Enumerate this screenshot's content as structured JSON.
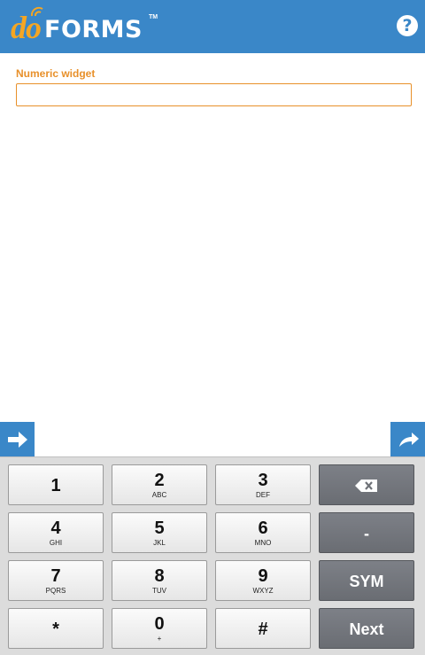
{
  "header": {
    "logo_do": "do",
    "logo_forms": "FORMS",
    "logo_tm": "TM",
    "help_label": "?"
  },
  "form": {
    "field_label": "Numeric widget",
    "field_value": ""
  },
  "keyboard": {
    "rows": [
      [
        {
          "main": "1",
          "sub": ""
        },
        {
          "main": "2",
          "sub": "ABC"
        },
        {
          "main": "3",
          "sub": "DEF"
        }
      ],
      [
        {
          "main": "4",
          "sub": "GHI"
        },
        {
          "main": "5",
          "sub": "JKL"
        },
        {
          "main": "6",
          "sub": "MNO"
        }
      ],
      [
        {
          "main": "7",
          "sub": "PQRS"
        },
        {
          "main": "8",
          "sub": "TUV"
        },
        {
          "main": "9",
          "sub": "WXYZ"
        }
      ],
      [
        {
          "main": "*",
          "sub": ""
        },
        {
          "main": "0",
          "sub": "+"
        },
        {
          "main": "#",
          "sub": ""
        }
      ]
    ],
    "side": {
      "minus": "-",
      "sym": "SYM",
      "next": "Next"
    }
  },
  "colors": {
    "brand_blue": "#3a87c8",
    "accent_orange": "#e8902a",
    "logo_orange": "#f5a623"
  }
}
